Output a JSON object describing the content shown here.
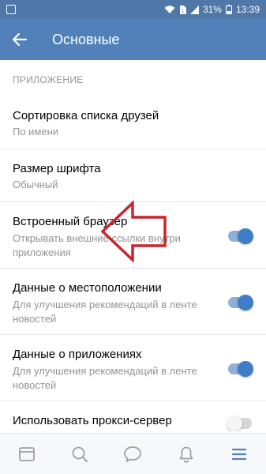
{
  "status_bar": {
    "battery": "31%",
    "time": "13:39",
    "icons": [
      "notification-box-icon",
      "wifi-icon",
      "sim-icon",
      "signal-icon",
      "battery-icon"
    ]
  },
  "app_bar": {
    "title": "Основные",
    "back_icon": "arrow-left-icon"
  },
  "section": {
    "header": "ПРИЛОЖЕНИЕ"
  },
  "items": [
    {
      "title": "Сортировка списка друзей",
      "subtitle": "По имени"
    },
    {
      "title": "Размер шрифта",
      "subtitle": "Обычный"
    },
    {
      "title": "Встроенный браузер",
      "subtitle": "Открывать внешние ссылки внутри приложения",
      "toggle": "on"
    },
    {
      "title": "Данные о местоположении",
      "subtitle": "Для улучшения рекомендаций в ленте новостей",
      "toggle": "on"
    },
    {
      "title": "Данные о приложениях",
      "subtitle": "Для улучшения рекомендаций в ленте новостей",
      "toggle": "on"
    },
    {
      "title": "Использовать прокси-сервер",
      "subtitle": "",
      "toggle": "off"
    }
  ],
  "annotation": {
    "color": "#c8262c",
    "icon": "arrow-left-outline-icon"
  },
  "bottom_nav": [
    "news-icon",
    "search-icon",
    "messages-icon",
    "notifications-icon",
    "menu-icon"
  ],
  "colors": {
    "accent": "#5181b8",
    "toggle_on": "#3f7ec6"
  }
}
